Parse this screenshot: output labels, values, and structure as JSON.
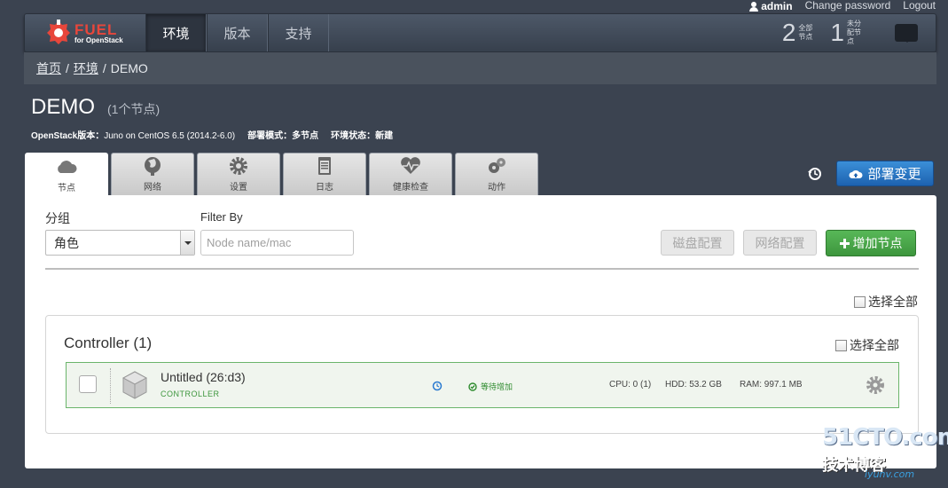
{
  "user_bar": {
    "username": "admin",
    "change_password": "Change password",
    "logout": "Logout"
  },
  "nav": {
    "logo_title": "FUEL",
    "logo_subtitle": "for OpenStack",
    "tabs": [
      "环境",
      "版本",
      "支持"
    ],
    "active_tab": "环境",
    "stats": [
      {
        "number": "2",
        "label": "全部节点"
      },
      {
        "number": "1",
        "label": "未分配节点"
      }
    ]
  },
  "breadcrumb": {
    "home": "首页",
    "env": "环境",
    "current": "DEMO",
    "sep": "/"
  },
  "cluster": {
    "name": "DEMO",
    "node_count": "(1个节点)",
    "openstack_label": "OpenStack版本：",
    "openstack_value": "Juno on CentOS 6.5 (2014.2-6.0)",
    "mode_label": "部署模式：",
    "mode_value": "多节点",
    "status_label": "环境状态：",
    "status_value": "新建"
  },
  "tabs": [
    {
      "label": "节点",
      "icon": "cloud-icon"
    },
    {
      "label": "网络",
      "icon": "globe-icon"
    },
    {
      "label": "设置",
      "icon": "gear-icon"
    },
    {
      "label": "日志",
      "icon": "clipboard-icon"
    },
    {
      "label": "健康检查",
      "icon": "heart-pulse-icon"
    },
    {
      "label": "动作",
      "icon": "gears-icon"
    }
  ],
  "deploy_button": "部署变更",
  "toolbar": {
    "group_label": "分组",
    "group_value": "角色",
    "filter_label": "Filter By",
    "filter_placeholder": "Node name/mac",
    "disk_config": "磁盘配置",
    "network_config": "网络配置",
    "add_node": "增加节点",
    "select_all": "选择全部"
  },
  "groups": [
    {
      "title": "Controller (1)",
      "select_all": "选择全部",
      "nodes": [
        {
          "name": "Untitled (26:d3)",
          "role": "CONTROLLER",
          "status": "等待增加",
          "cpu": "CPU: 0 (1)",
          "hdd": "HDD: 53.2 GB",
          "ram": "RAM: 997.1 MB"
        }
      ]
    }
  ],
  "watermark": {
    "main": "51CTO.com",
    "sub": "技术博客",
    "sub2": "运维网",
    "url": "iyunv.com"
  },
  "colors": {
    "accent_blue": "#1d62b0",
    "success_green": "#3d963d",
    "logo_red": "#e8463b"
  }
}
